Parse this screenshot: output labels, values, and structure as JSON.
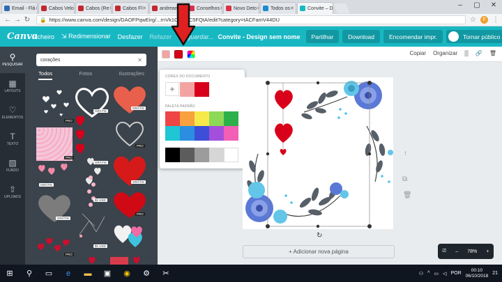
{
  "browser": {
    "tabs": [
      {
        "label": "Email - Flá",
        "fav": "#2d6ab3"
      },
      {
        "label": "Cabos Velo",
        "fav": "#c0282d"
      },
      {
        "label": "Cabos (Re",
        "fav": "#c0282d"
      },
      {
        "label": "Cabos Fl",
        "fav": "#c0282d"
      },
      {
        "label": "andreamo",
        "fav": "#c0282d"
      },
      {
        "label": "Conselhos",
        "fav": "#d8324a"
      },
      {
        "label": "Novo Deto",
        "fav": "#d8324a"
      },
      {
        "label": "Todos os",
        "fav": "#1a8ad6"
      },
      {
        "label": "Convite – D",
        "fav": "#18b8c3"
      }
    ],
    "window_controls": [
      "–",
      "▢",
      "✕"
    ],
    "url": "https://www.canva.com/design/DAOFPqwEirg/...rnVk1CpmAC5FQtA/edit?category=tACFamV44DU",
    "profile_initial": "F"
  },
  "topbar": {
    "logo": "Canva",
    "file": "Ficheiro",
    "resize": "Redimensionar",
    "undo": "Desfazer",
    "redo": "Refazer",
    "saving": "A guardar...",
    "doc_title": "Convite - Design sem nome",
    "share": "Partilhar",
    "download": "Download",
    "order": "Encomendar impr.",
    "publish": "Tornar público"
  },
  "rail": [
    {
      "icon": "⚲",
      "label": "PESQUISAR",
      "active": true
    },
    {
      "icon": "▦",
      "label": "LAYOUTS"
    },
    {
      "icon": "♡",
      "label": "ELEMENTOS"
    },
    {
      "icon": "T",
      "label": "TEXTO"
    },
    {
      "icon": "▨",
      "label": "FUNDO"
    },
    {
      "icon": "⇧",
      "label": "UPLOADS"
    }
  ],
  "panel": {
    "search_value": "corações",
    "tabs": [
      "Todos",
      "Fotos",
      "Ilustrações"
    ],
    "badges": {
      "gratis": "GRÁTIS",
      "pro": "PRO",
      "price": "$1 USD"
    }
  },
  "toolbar": {
    "copy": "Copiar",
    "organize": "Organizar"
  },
  "picker": {
    "doc_colors_title": "CORES DO DOCUMENTO",
    "doc_colors": [
      "#f4a3a3",
      "#d8001a"
    ],
    "palette_title": "PALETA PADRÃO",
    "palette": [
      "#ee4545",
      "#f7a13f",
      "#f6e94a",
      "#8ed857",
      "#2db049",
      "#1fc6d3",
      "#2b8ee0",
      "#3c4fd6",
      "#a34fdc",
      "#f25fb6",
      "#000000",
      "#5c5c5c",
      "#9c9c9c",
      "#d6d6d6",
      "#ffffff"
    ]
  },
  "canvas": {
    "add_page": "+ Adicionar nova página"
  },
  "zoom": {
    "value": "78%"
  },
  "taskbar": {
    "lang": "POR",
    "time": "00:10",
    "date": "06/10/2018",
    "notif": "21"
  },
  "colors": {
    "canva_teal": "#18b8c3",
    "arrow_red": "#e02020"
  }
}
